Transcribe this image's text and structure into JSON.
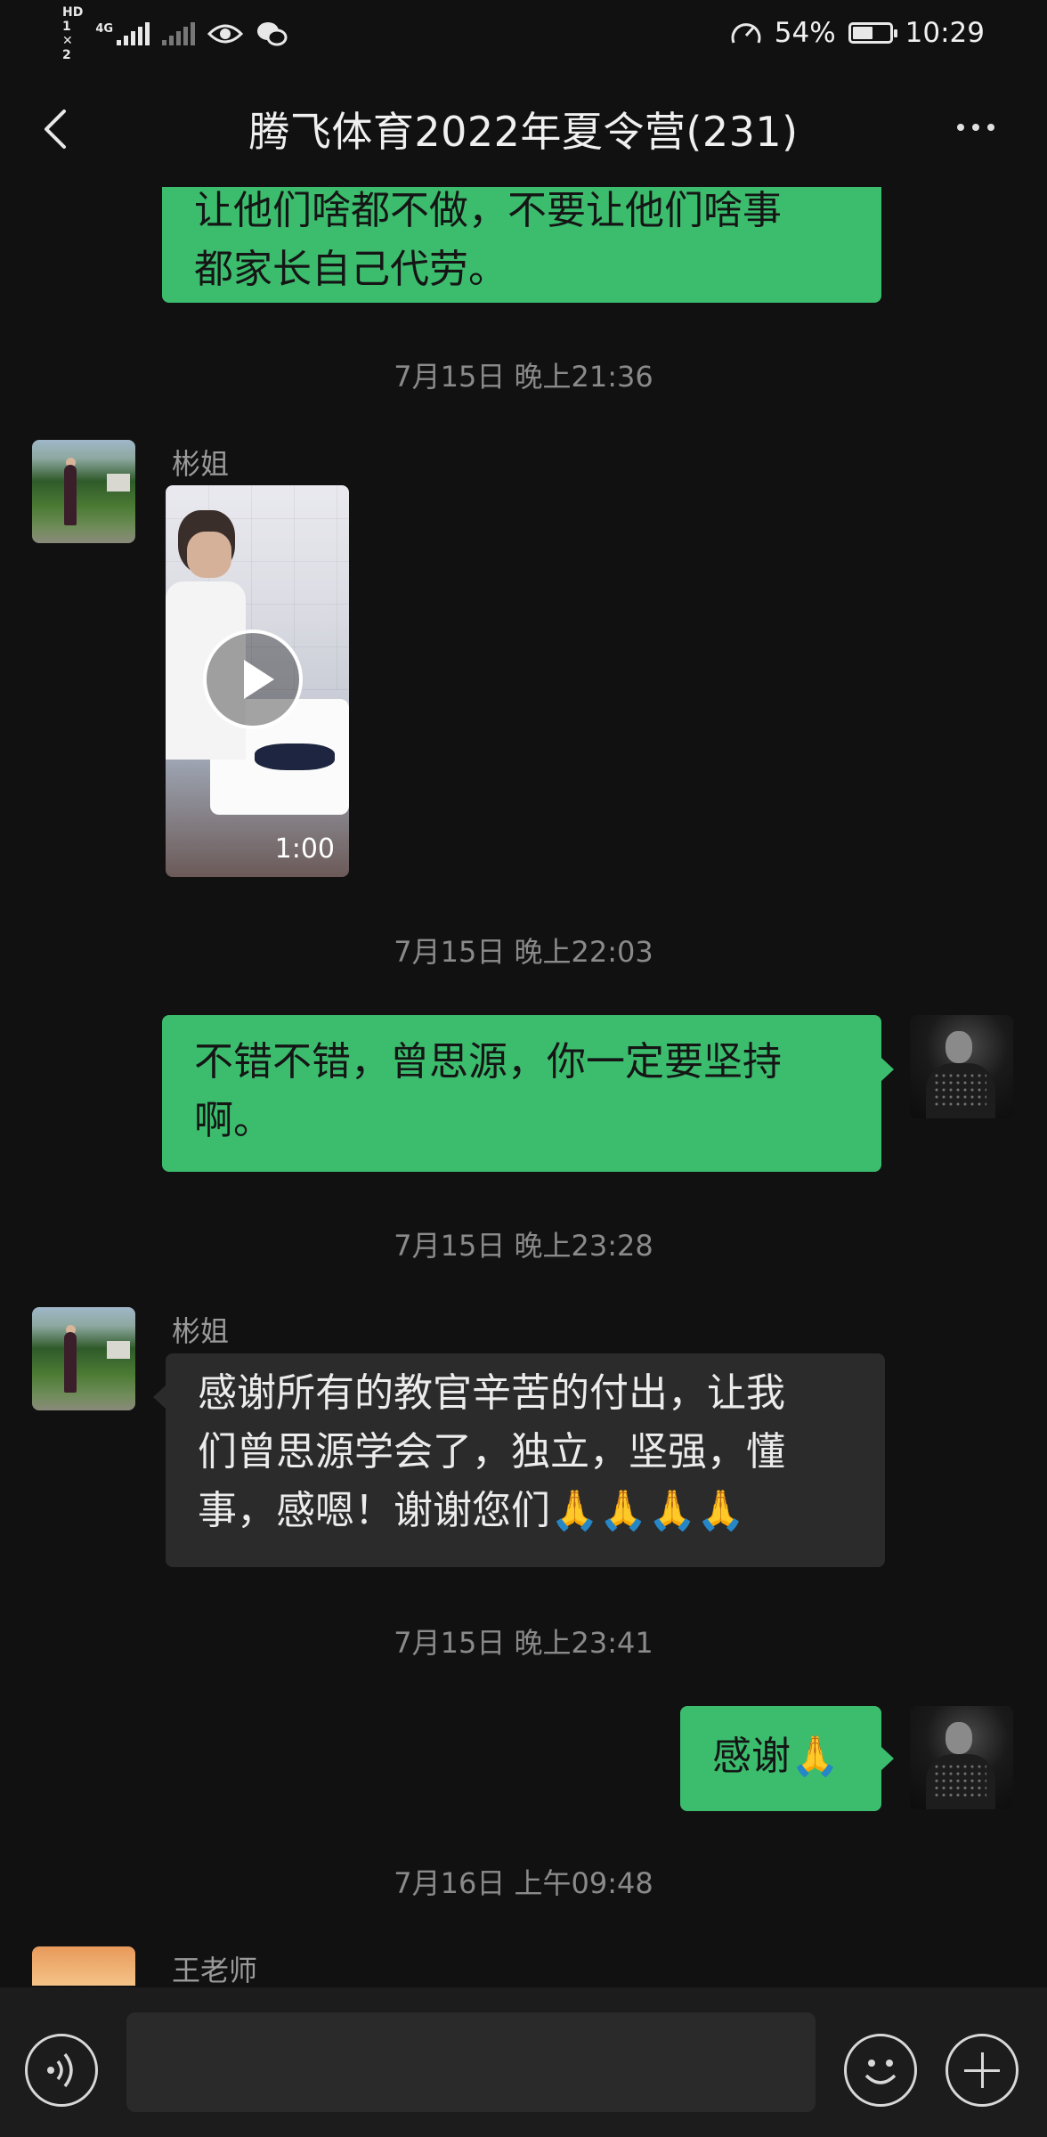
{
  "status_bar": {
    "hd_label": "HD",
    "sim1": "1",
    "sim2": "2",
    "network": "4G",
    "battery": "54%",
    "battery_level": 0.54,
    "time": "10:29"
  },
  "header": {
    "title": "腾飞体育2022年夏令营(231)",
    "back_icon": "chevron-left-icon",
    "more_icon": "more-horizontal-icon"
  },
  "messages": [
    {
      "type": "text",
      "side": "right",
      "lines": [
        "让他们啥都不做，不要让他们啥事",
        "都家长自己代劳。"
      ]
    },
    {
      "type": "timestamp",
      "text": "7月15日 晚上21:36"
    },
    {
      "type": "video",
      "side": "left",
      "sender": "彬姐",
      "duration": "1:00"
    },
    {
      "type": "timestamp",
      "text": "7月15日 晚上22:03"
    },
    {
      "type": "text",
      "side": "right",
      "lines": [
        "不错不错，曾思源，你一定要坚持",
        "啊。"
      ]
    },
    {
      "type": "timestamp",
      "text": "7月15日 晚上23:28"
    },
    {
      "type": "text",
      "side": "left",
      "sender": "彬姐",
      "lines": [
        "感谢所有的教官辛苦的付出，让我",
        "们曾思源学会了，独立，坚强，懂",
        "事，感嗯！谢谢您们🙏🙏🙏🙏"
      ]
    },
    {
      "type": "timestamp",
      "text": "7月15日 晚上23:41"
    },
    {
      "type": "text",
      "side": "right",
      "lines": [
        "感谢🙏"
      ]
    },
    {
      "type": "timestamp",
      "text": "7月16日 上午09:48"
    },
    {
      "type": "partial",
      "side": "left",
      "sender": "王老师"
    }
  ],
  "input_bar": {
    "placeholder": "",
    "voice_icon": "voice-icon",
    "emoji_icon": "emoji-icon",
    "plus_icon": "plus-icon"
  },
  "colors": {
    "background": "#111111",
    "own_bubble": "#3cbd6e",
    "other_bubble": "#2b2b2b",
    "timestamp": "#8a8a8a"
  }
}
